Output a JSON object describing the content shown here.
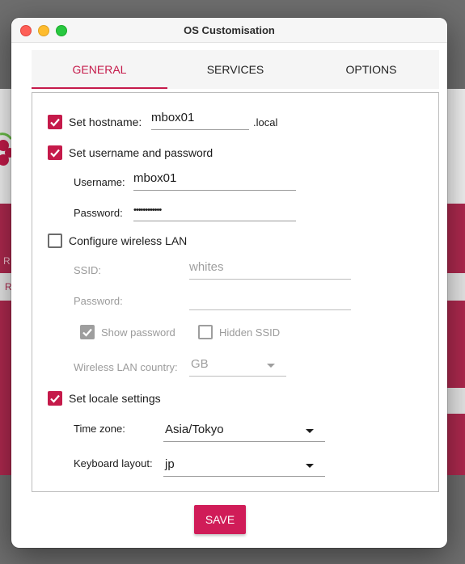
{
  "window": {
    "title": "OS Customisation"
  },
  "tabs": [
    {
      "label": "GENERAL",
      "active": true
    },
    {
      "label": "SERVICES",
      "active": false
    },
    {
      "label": "OPTIONS",
      "active": false
    }
  ],
  "general": {
    "hostname": {
      "checked": true,
      "label": "Set hostname:",
      "value": "mbox01",
      "suffix": ".local"
    },
    "user": {
      "checked": true,
      "label": "Set username and password",
      "username_label": "Username:",
      "username": "mbox01",
      "password_label": "Password:",
      "password": "••••••••••••"
    },
    "wlan": {
      "checked": false,
      "label": "Configure wireless LAN",
      "ssid_label": "SSID:",
      "ssid": "whites",
      "password_label": "Password:",
      "password": "",
      "show_password": {
        "label": "Show password",
        "checked": true
      },
      "hidden_ssid": {
        "label": "Hidden SSID",
        "checked": false
      },
      "country_label": "Wireless LAN country:",
      "country": "GB"
    },
    "locale": {
      "checked": true,
      "label": "Set locale settings",
      "timezone_label": "Time zone:",
      "timezone": "Asia/Tokyo",
      "keyboard_label": "Keyboard layout:",
      "keyboard": "jp"
    }
  },
  "save_label": "SAVE",
  "background": {
    "text1": "R",
    "text2": "R"
  },
  "colors": {
    "accent": "#c51a4a",
    "save": "#d01c58"
  }
}
